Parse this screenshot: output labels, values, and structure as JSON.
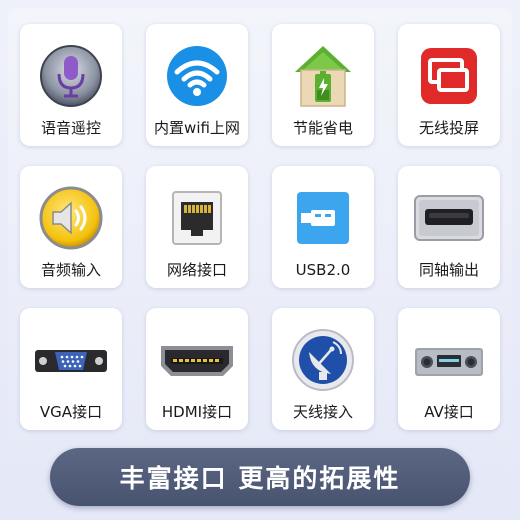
{
  "features": [
    {
      "label": "语音遥控",
      "icon": "microphone-icon"
    },
    {
      "label": "内置wifi上网",
      "icon": "wifi-icon"
    },
    {
      "label": "节能省电",
      "icon": "eco-battery-house-icon"
    },
    {
      "label": "无线投屏",
      "icon": "screen-cast-icon"
    },
    {
      "label": "音频输入",
      "icon": "speaker-icon"
    },
    {
      "label": "网络接口",
      "icon": "ethernet-port-icon"
    },
    {
      "label": "USB2.0",
      "icon": "usb-icon"
    },
    {
      "label": "同轴输出",
      "icon": "coaxial-port-icon"
    },
    {
      "label": "VGA接口",
      "icon": "vga-port-icon"
    },
    {
      "label": "HDMI接口",
      "icon": "hdmi-port-icon"
    },
    {
      "label": "天线接入",
      "icon": "satellite-antenna-icon"
    },
    {
      "label": "AV接口",
      "icon": "av-receiver-icon"
    }
  ],
  "banner": {
    "text": "丰富接口 更高的拓展性"
  },
  "colors": {
    "banner_background": "#4f5a77",
    "wifi_blue": "#1a8fe6",
    "cast_red": "#e02a2a",
    "eco_green": "#5cb030",
    "usb_blue": "#3ba6ee",
    "speaker_yellow": "#f4c20d"
  }
}
